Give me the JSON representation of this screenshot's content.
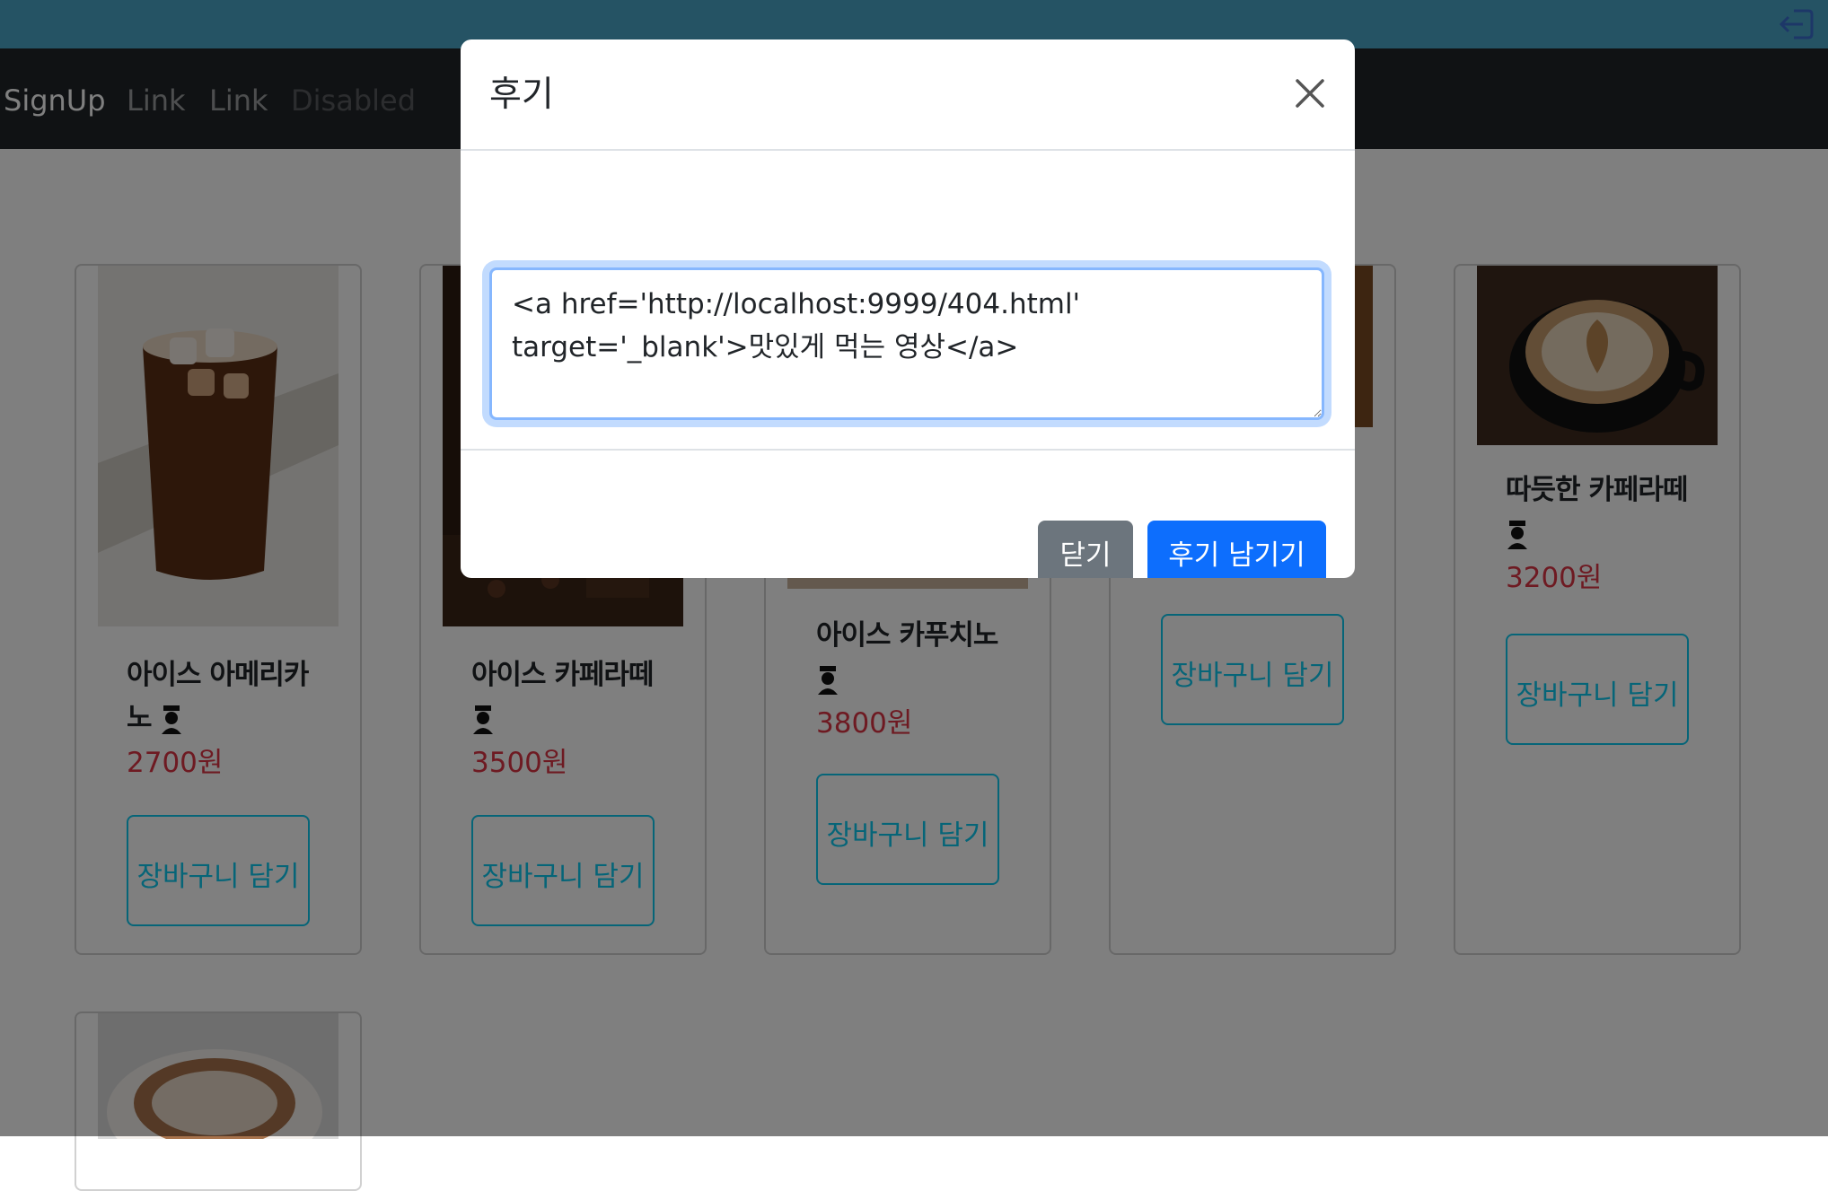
{
  "navbar": {
    "brand": "SignUp",
    "links": [
      "Link",
      "Link"
    ],
    "disabled_link": "Disabled"
  },
  "colors": {
    "topbar": "#4ba6c9",
    "navbar": "#212529",
    "price": "#dc3545",
    "cart_button": "#0dcaf0",
    "primary": "#0d6efd",
    "secondary": "#6c757d"
  },
  "icons": {
    "logout": "logout-icon",
    "close": "close-icon",
    "person": "person-icon"
  },
  "products": [
    {
      "name": "아이스 아메리카노",
      "price": "2700원",
      "cart_label": "장바구니 담기"
    },
    {
      "name": "아이스 카페라떼",
      "price": "3500원",
      "cart_label": "장바구니 담기"
    },
    {
      "name": "아이스 카푸치노",
      "price": "3800원",
      "cart_label": "장바구니 담기"
    },
    {
      "name": "",
      "price": "",
      "cart_label": "장바구니 담기"
    },
    {
      "name": "따듯한 카페라떼",
      "price": "3200원",
      "cart_label": "장바구니 담기"
    }
  ],
  "modal": {
    "title": "후기",
    "review_text": "<a href='http://localhost:9999/404.html' target='_blank'>맛있게 먹는 영상</a>",
    "close_button": "닫기",
    "submit_button": "후기 남기기"
  }
}
